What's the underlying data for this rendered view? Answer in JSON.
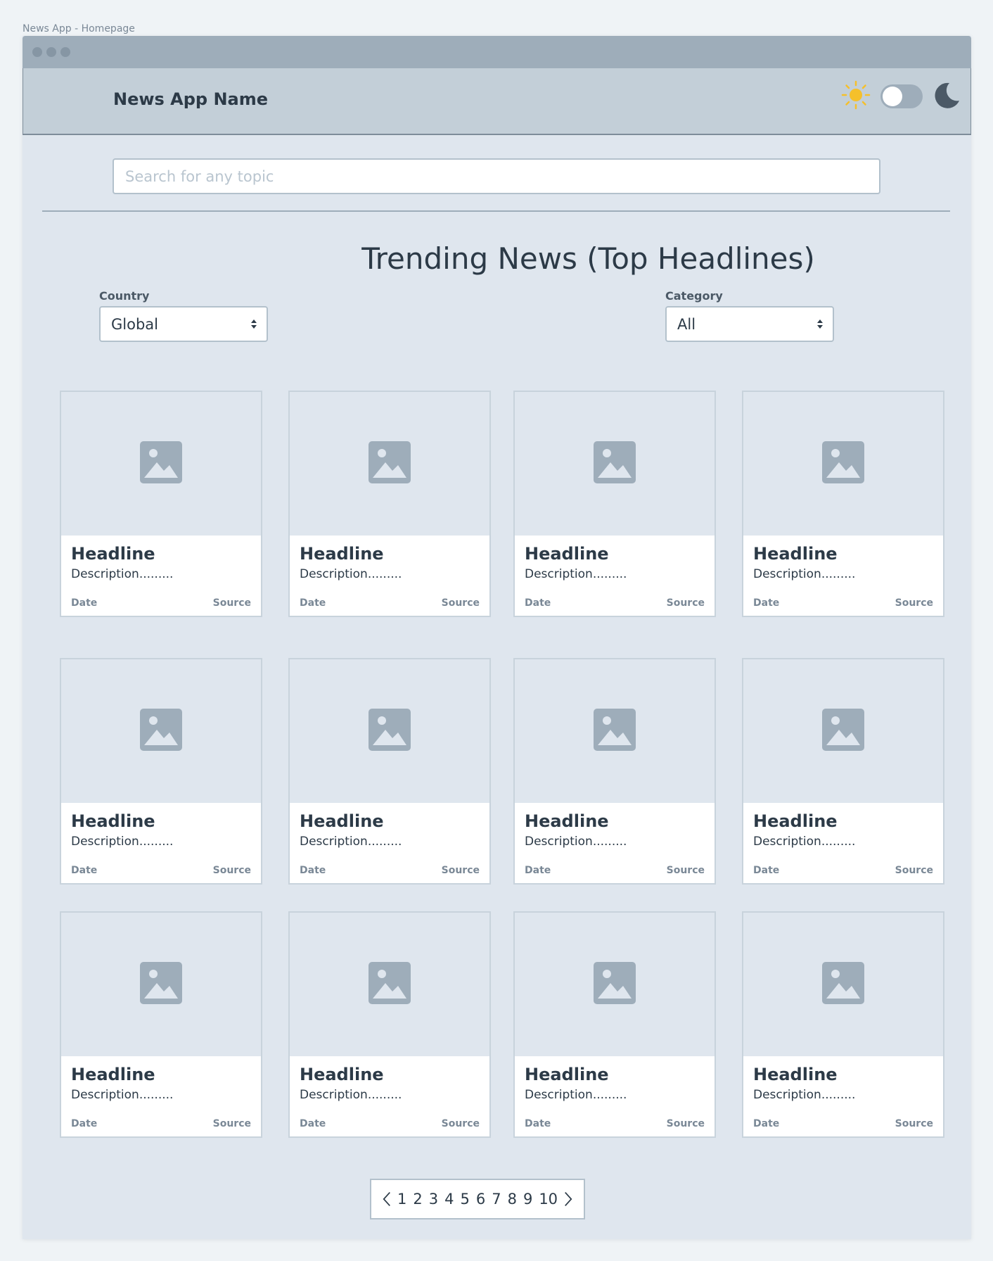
{
  "caption": "News App - Homepage",
  "app": {
    "name": "News App Name"
  },
  "theme": {
    "light_icon": "sun-icon",
    "dark_icon": "moon-icon",
    "toggle_state": "light",
    "sun_color": "#f5c02b",
    "moon_color": "#4b5966"
  },
  "search": {
    "placeholder": "Search for any topic",
    "value": ""
  },
  "page_title": "Trending News (Top Headlines)",
  "filters": {
    "country": {
      "label": "Country",
      "value": "Global"
    },
    "category": {
      "label": "Category",
      "value": "All"
    }
  },
  "articles": [
    {
      "headline": "Headline",
      "description": "Description.........",
      "date": "Date",
      "source": "Source"
    },
    {
      "headline": "Headline",
      "description": "Description.........",
      "date": "Date",
      "source": "Source"
    },
    {
      "headline": "Headline",
      "description": "Description.........",
      "date": "Date",
      "source": "Source"
    },
    {
      "headline": "Headline",
      "description": "Description.........",
      "date": "Date",
      "source": "Source"
    },
    {
      "headline": "Headline",
      "description": "Description.........",
      "date": "Date",
      "source": "Source"
    },
    {
      "headline": "Headline",
      "description": "Description.........",
      "date": "Date",
      "source": "Source"
    },
    {
      "headline": "Headline",
      "description": "Description.........",
      "date": "Date",
      "source": "Source"
    },
    {
      "headline": "Headline",
      "description": "Description.........",
      "date": "Date",
      "source": "Source"
    },
    {
      "headline": "Headline",
      "description": "Description.........",
      "date": "Date",
      "source": "Source"
    },
    {
      "headline": "Headline",
      "description": "Description.........",
      "date": "Date",
      "source": "Source"
    },
    {
      "headline": "Headline",
      "description": "Description.........",
      "date": "Date",
      "source": "Source"
    },
    {
      "headline": "Headline",
      "description": "Description.........",
      "date": "Date",
      "source": "Source"
    }
  ],
  "pagination": {
    "pages": [
      "1",
      "2",
      "3",
      "4",
      "5",
      "6",
      "7",
      "8",
      "9",
      "10"
    ],
    "prev_icon": "chevron-left-icon",
    "next_icon": "chevron-right-icon"
  }
}
